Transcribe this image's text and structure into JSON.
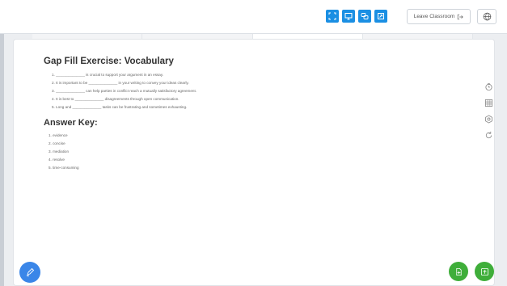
{
  "toolbar": {
    "buttons": [
      {
        "icon": "fullscreen-icon"
      },
      {
        "icon": "screen-share-icon"
      },
      {
        "icon": "chat-icon"
      },
      {
        "icon": "popout-icon"
      }
    ],
    "leave_label": "Leave Classroom",
    "accent_color": "#1a8fe3"
  },
  "document": {
    "title": "Gap Fill Exercise: Vocabulary",
    "questions": [
      "1. ______________ is crucial to support your argument in an essay.",
      "2. It is important to be ______________ in your writing to convey your ideas clearly.",
      "3. ______________ can help parties in conflict reach a mutually satisfactory agreement.",
      "4. It is best to ______________ disagreements through open communication.",
      "5. Long and ______________ tasks can be frustrating and sometimes exhausting."
    ],
    "answer_heading": "Answer Key:",
    "answers": [
      "1. evidence",
      "2. concise",
      "3. mediation",
      "4. resolve",
      "5. time-consuming"
    ]
  },
  "side_tools": [
    "timer-icon",
    "grid-icon",
    "settings-icon",
    "refresh-icon"
  ],
  "fab": {
    "left_color": "#3a86e8",
    "right_color": "#3fae3a"
  }
}
